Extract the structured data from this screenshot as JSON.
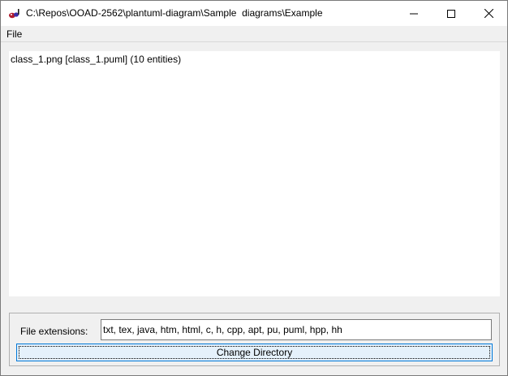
{
  "window": {
    "title": "C:\\Repos\\OOAD-2562\\plantuml-diagram\\Sample  diagrams\\Example",
    "icon": "plantuml-app-icon",
    "buttons": {
      "minimize": "minimize-icon",
      "maximize": "maximize-icon",
      "close": "close-icon"
    }
  },
  "menubar": {
    "items": [
      {
        "label": "File"
      }
    ]
  },
  "file_list": {
    "items": [
      {
        "text": "class_1.png [class_1.puml] (10 entities)"
      }
    ]
  },
  "controls": {
    "extensions_label": "File extensions:",
    "extensions_value": "txt, tex, java, htm, html, c, h, cpp, apt, pu, puml, hpp, hh",
    "change_directory_label": "Change Directory"
  },
  "colors": {
    "focus_border": "#0078d7",
    "button_bg": "#e5f1fb",
    "window_bg": "#f0f0f0"
  }
}
